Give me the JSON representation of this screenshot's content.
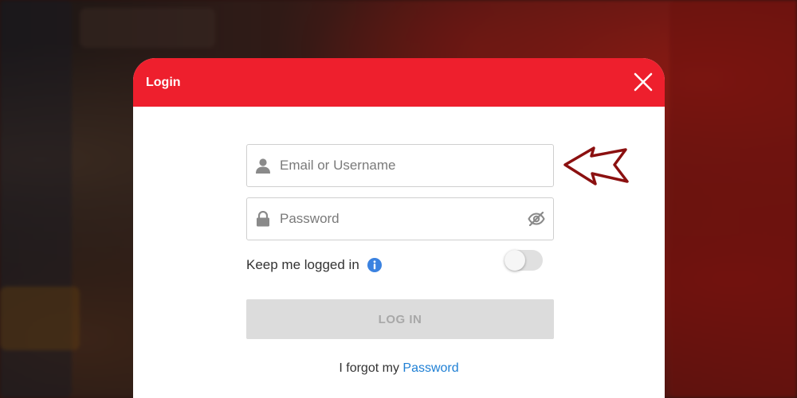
{
  "dialog": {
    "title": "Login",
    "close_icon": "close-icon"
  },
  "form": {
    "username": {
      "placeholder": "Email or Username",
      "value": "",
      "icon": "user-icon"
    },
    "password": {
      "placeholder": "Password",
      "value": "",
      "icon": "lock-icon",
      "visibility_icon": "eye-slash-icon"
    },
    "keep_logged_in": {
      "label": "Keep me logged in",
      "info_icon": "info-icon",
      "enabled": false
    },
    "login_button": {
      "label": "LOG IN",
      "disabled": true
    },
    "forgot": {
      "prefix": "I forgot my",
      "link": "Password"
    }
  },
  "annotation": {
    "arrow_icon": "arrow-left-icon"
  },
  "colors": {
    "header": "#ee1f2d",
    "link": "#1e7fd4",
    "info": "#3b82e0",
    "button_disabled": "#dcdcdc",
    "arrow_outline": "#8b1010"
  }
}
